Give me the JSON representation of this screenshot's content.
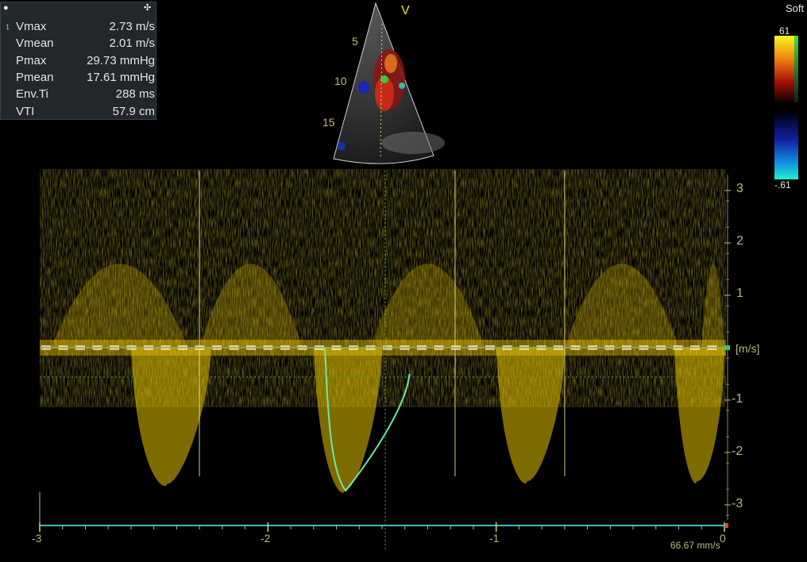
{
  "measurements": {
    "index": "1",
    "rows": [
      {
        "label": "Vmax",
        "value": "2.73 m/s"
      },
      {
        "label": "Vmean",
        "value": "2.01 m/s"
      },
      {
        "label": "Pmax",
        "value": "29.73 mmHg"
      },
      {
        "label": "Pmean",
        "value": "17.61 mmHg"
      },
      {
        "label": "Env.Ti",
        "value": "288 ms"
      },
      {
        "label": "VTI",
        "value": "57.9 cm"
      }
    ]
  },
  "echo_view": {
    "marker": "V",
    "depth_labels": [
      "5",
      "10",
      "15"
    ]
  },
  "color_map": {
    "preset": "Soft",
    "top_value": "61",
    "bottom_value": "-.61"
  },
  "doppler": {
    "velocity_ticks": [
      "3",
      "2",
      "1",
      "-1",
      "-2",
      "-3"
    ],
    "velocity_unit": "[m/s]",
    "time_ticks": [
      "-3",
      "-2",
      "-1",
      "0"
    ],
    "sweep_speed": "66.67 mm/s"
  },
  "colors": {
    "spectrum": "#e6c200",
    "trace": "#6ee89a",
    "baseline": "#9aa48c",
    "sweep_line": "#3fb8c0"
  }
}
